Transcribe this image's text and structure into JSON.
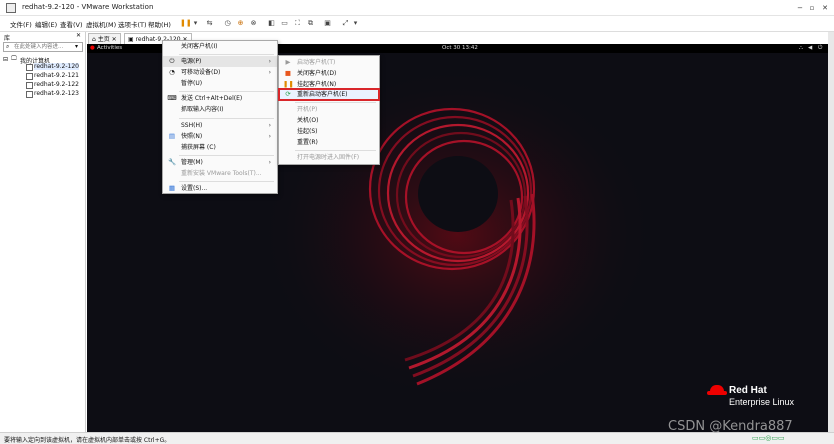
{
  "window": {
    "title": "redhat-9.2-120 - VMware Workstation"
  },
  "menubar": {
    "items": [
      "文件(F)",
      "编辑(E)",
      "查看(V)",
      "虚拟机(M)",
      "选项卡(T)",
      "帮助(H)"
    ]
  },
  "sidebar": {
    "header": "库",
    "search_placeholder": "在此处键入内容进...",
    "root": "我的计算机",
    "vms": [
      "redhat-9.2-120",
      "redhat-9.2-121",
      "redhat-9.2-122",
      "redhat-9.2-123"
    ]
  },
  "tabs": {
    "home": "主页",
    "vm": "redhat-9.2-120"
  },
  "vm_screen": {
    "activities": "Activities",
    "clock": "Oct 30 13:42"
  },
  "context_menu": {
    "items": [
      {
        "label": "关闭客户机(I)",
        "icon": ""
      },
      {
        "label": "电源(P)",
        "icon": "power-icon",
        "arrow": true
      },
      {
        "label": "可移动设备(D)",
        "icon": "device-icon",
        "arrow": true
      },
      {
        "label": "暂停(U)",
        "icon": ""
      },
      {
        "label": "发送 Ctrl+Alt+Del(E)",
        "icon": "keyboard-icon"
      },
      {
        "label": "抓取输入内容(I)",
        "icon": ""
      },
      {
        "label": "SSH(H)",
        "icon": "",
        "arrow": true
      },
      {
        "label": "快照(N)",
        "icon": "snapshot-icon",
        "arrow": true
      },
      {
        "label": "捕获屏幕 (C)",
        "icon": ""
      },
      {
        "label": "管理(M)",
        "icon": "wrench-icon",
        "arrow": true
      },
      {
        "label": "重新安装 VMware Tools(T)...",
        "icon": ""
      },
      {
        "label": "设置(S)...",
        "icon": "settings-icon"
      }
    ]
  },
  "power_submenu": {
    "items": [
      {
        "label": "启动客户机(T)",
        "disabled": true
      },
      {
        "label": "关闭客户机(D)"
      },
      {
        "label": "挂起客户机(N)"
      },
      {
        "label": "重新启动客户机(E)",
        "highlighted": true
      },
      {
        "label": "开机(P)",
        "disabled": true
      },
      {
        "label": "关机(O)"
      },
      {
        "label": "挂起(S)"
      },
      {
        "label": "重置(R)"
      },
      {
        "label": "打开电源时进入固件(F)",
        "disabled": true
      }
    ]
  },
  "branding": {
    "line1": "Red Hat",
    "line2": "Enterprise Linux"
  },
  "status": {
    "text": "要将输入定向到该虚拟机，请在虚拟机内部单击或按 Ctrl+G。"
  },
  "watermark": "CSDN @Kendra887",
  "colors": {
    "highlight_border": "#d9262a",
    "redhat_red": "#e00",
    "vm_bg": "#0d0d12"
  }
}
